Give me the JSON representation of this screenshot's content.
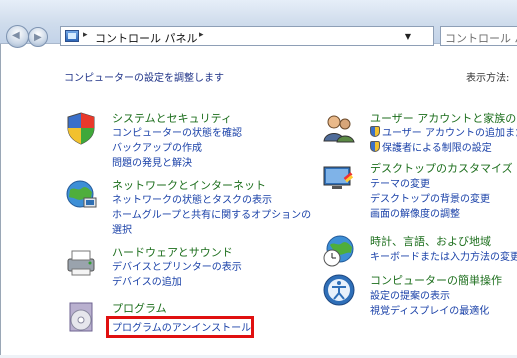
{
  "window": {
    "address": {
      "path_label": "コントロール パネル",
      "separator": "▸"
    },
    "search_placeholder": "コントロール パネ"
  },
  "page": {
    "heading": "コンピューターの設定を調整します",
    "view_by": "表示方法:"
  },
  "categories": {
    "system": {
      "title": "システムとセキュリティ",
      "links": [
        "コンピューターの状態を確認",
        "バックアップの作成",
        "問題の発見と解決"
      ]
    },
    "network": {
      "title": "ネットワークとインターネット",
      "links": [
        "ネットワークの状態とタスクの表示",
        "ホームグループと共有に関するオプションの",
        "選択"
      ]
    },
    "hardware": {
      "title": "ハードウェアとサウンド",
      "links": [
        "デバイスとプリンターの表示",
        "デバイスの追加"
      ]
    },
    "programs": {
      "title": "プログラム",
      "links": [
        "プログラムのアンインストール"
      ]
    },
    "users": {
      "title": "ユーザー アカウントと家族のため",
      "links": [
        "ユーザー アカウントの追加また",
        "保護者による制限の設定"
      ]
    },
    "appearance": {
      "title": "デスクトップのカスタマイズ",
      "links": [
        "テーマの変更",
        "デスクトップの背景の変更",
        "画面の解像度の調整"
      ]
    },
    "clock": {
      "title": "時計、言語、および地域",
      "links": [
        "キーボードまたは入力方法の変更"
      ]
    },
    "ease": {
      "title": "コンピューターの簡単操作",
      "links": [
        "設定の提案の表示",
        "視覚ディスプレイの最適化"
      ]
    }
  },
  "colors": {
    "category_title": "#1c6e1c",
    "link": "#1a41a8",
    "highlight": "#e01010"
  }
}
